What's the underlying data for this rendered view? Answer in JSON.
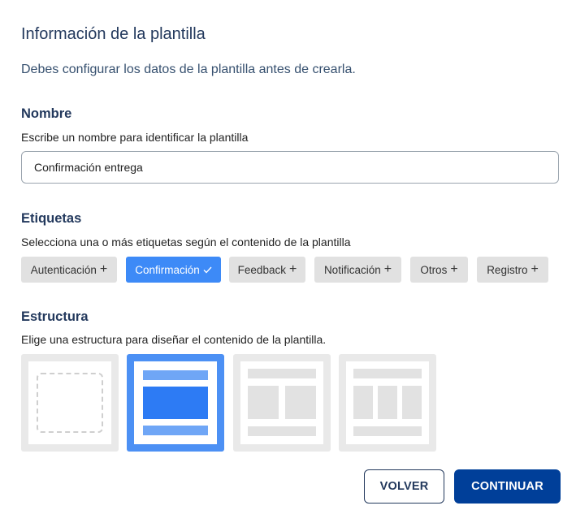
{
  "header": {
    "title": "Información de la plantilla",
    "subtitle": "Debes configurar los datos de la plantilla antes de crearla."
  },
  "name_section": {
    "title": "Nombre",
    "description": "Escribe un nombre para identificar la plantilla",
    "input_value": "Confirmación entrega"
  },
  "tags_section": {
    "title": "Etiquetas",
    "description": "Selecciona una o más etiquetas según el contenido de la plantilla",
    "tags": [
      {
        "label": "Autenticación",
        "icon": "plus-icon",
        "selected": false
      },
      {
        "label": "Confirmación",
        "icon": "check-icon",
        "selected": true
      },
      {
        "label": "Feedback",
        "icon": "plus-icon",
        "selected": false
      },
      {
        "label": "Notificación",
        "icon": "plus-icon",
        "selected": false
      },
      {
        "label": "Otros",
        "icon": "plus-icon",
        "selected": false
      },
      {
        "label": "Registro",
        "icon": "plus-icon",
        "selected": false
      }
    ]
  },
  "structure_section": {
    "title": "Estructura",
    "description": "Elige una estructura para diseñar el contenido de la plantilla.",
    "options": [
      {
        "icon": "empty-layout-icon",
        "selected": false
      },
      {
        "icon": "single-column-layout-icon",
        "selected": true
      },
      {
        "icon": "two-column-layout-icon",
        "selected": false
      },
      {
        "icon": "three-column-layout-icon",
        "selected": false
      }
    ]
  },
  "actions": {
    "back_label": "VOLVER",
    "continue_label": "CONTINUAR"
  },
  "colors": {
    "primary": "#003f99",
    "accent": "#3d8af7",
    "heading": "#23395d"
  }
}
